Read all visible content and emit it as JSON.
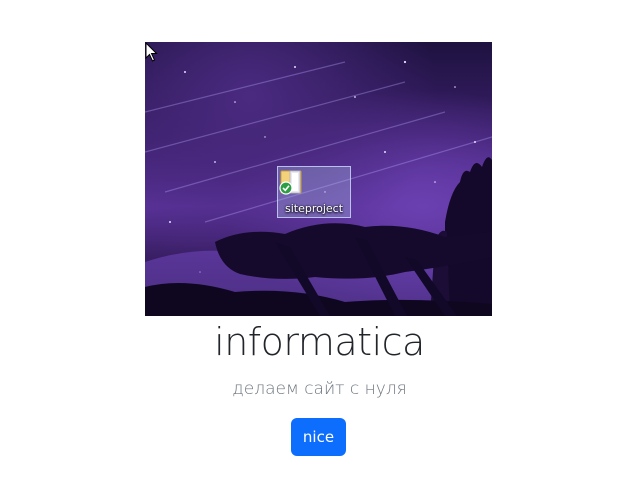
{
  "hero": {
    "image_description_icon": "desktop-wallpaper",
    "desktop_icon": {
      "label": "siteproject",
      "icon": "folder-with-sync-check-icon"
    },
    "cursor_icon": "mouse-pointer-icon"
  },
  "title": "informatica",
  "subtitle": "делаем сайт с нуля",
  "button": {
    "label": "nice",
    "color": "#0d6efd"
  },
  "colors": {
    "title": "#212529",
    "subtitle": "#6c757d",
    "background": "#ffffff"
  }
}
